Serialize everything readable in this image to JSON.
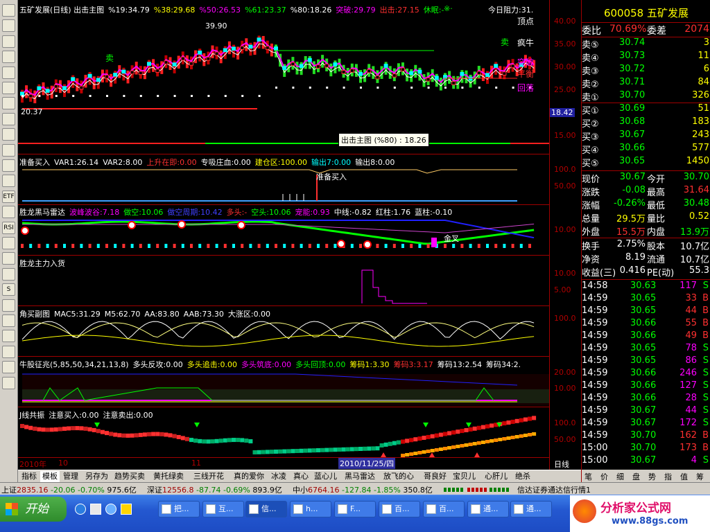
{
  "left_toolbar": {
    "buttons": [
      "",
      "",
      "",
      "",
      "",
      "",
      "",
      "",
      "",
      "",
      "",
      "",
      "ETF",
      "",
      "RSI",
      "",
      "",
      "",
      "S",
      "",
      "",
      "",
      "",
      "",
      ""
    ]
  },
  "main_pane": {
    "title_parts": [
      {
        "text": "五矿发展(日线) 出击主图",
        "color": "#ffffff"
      },
      {
        "text": "%19:34.79",
        "color": "#ffffff"
      },
      {
        "text": "%38:29.68",
        "color": "#ffff00"
      },
      {
        "text": "%50:26.53",
        "color": "#ff00ff"
      },
      {
        "text": "%61:23.37",
        "color": "#00ff00"
      },
      {
        "text": "%80:18.26",
        "color": "#ffffff"
      },
      {
        "text": "突破:29.79",
        "color": "#ff00ff"
      },
      {
        "text": "出击:27.15",
        "color": "#ff3030"
      },
      {
        "text": "休眠:-",
        "color": "#00ff00"
      }
    ],
    "x_mark": "※·",
    "resistance": "今日阻力:31.",
    "price_high_label": "39.90",
    "price_low_label": "20.37",
    "current_price_tag": "18.42",
    "tooltip": "出击主图 (%80) : 18.26",
    "labels": [
      {
        "text": "顶点",
        "color": "#ffffff"
      },
      {
        "text": "疯牛",
        "color": "#ffffff"
      },
      {
        "text": "突破",
        "color": "#ff00ff"
      },
      {
        "text": "平衡",
        "color": "#ff3030"
      },
      {
        "text": "回落",
        "color": "#ff00ff"
      }
    ],
    "sell_marks": [
      "卖",
      "卖"
    ],
    "y_ticks": [
      "40.00",
      "35.00",
      "30.00",
      "25.00",
      "20.00",
      "15.00"
    ]
  },
  "pane2": {
    "title_parts": [
      {
        "text": "准备买入",
        "color": "#ffffff"
      },
      {
        "text": "VAR1:26.14",
        "color": "#ffffff"
      },
      {
        "text": "VAR2:8.00",
        "color": "#ffffff"
      },
      {
        "text": "上升在即:0.00",
        "color": "#ff3030"
      },
      {
        "text": "专吸庄血:0.00",
        "color": "#ffffff"
      },
      {
        "text": "建仓区:100.00",
        "color": "#ffff00"
      },
      {
        "text": "输出7:0.00",
        "color": "#00ffff"
      },
      {
        "text": "输出8:0.00",
        "color": "#ffffff"
      }
    ],
    "marker": "准备买入",
    "y_ticks": [
      "100.0",
      "50.00"
    ]
  },
  "pane3": {
    "title_parts": [
      {
        "text": "胜龙黑马雷达",
        "color": "#ffffff"
      },
      {
        "text": "波峰波谷:7.18",
        "color": "#ff00ff"
      },
      {
        "text": "做空:10.06",
        "color": "#00ff00"
      },
      {
        "text": "做空周期:10.42",
        "color": "#4040ff"
      },
      {
        "text": "多头:-",
        "color": "#ff3030"
      },
      {
        "text": "空头:10.06",
        "color": "#00ff00"
      },
      {
        "text": "宠能:0.93",
        "color": "#ff00ff"
      },
      {
        "text": "中线:-0.82",
        "color": "#ffffff"
      },
      {
        "text": "红柱:1.76",
        "color": "#ffffff"
      },
      {
        "text": "蓝柱:-0.10",
        "color": "#ffffff"
      }
    ],
    "marker": "金叉",
    "y_ticks": [
      "10.00"
    ]
  },
  "pane4": {
    "title": "胜龙主力入货",
    "y_ticks": [
      "10.00",
      "5.00"
    ]
  },
  "pane5": {
    "title_parts": [
      {
        "text": "角买副图",
        "color": "#ffffff"
      },
      {
        "text": "MAC5:31.29",
        "color": "#ffffff"
      },
      {
        "text": "M5:62.70",
        "color": "#ffffff"
      },
      {
        "text": "AA:83.80",
        "color": "#ffffff"
      },
      {
        "text": "AAB:73.30",
        "color": "#ffffff"
      },
      {
        "text": "大涨区:0.00",
        "color": "#ffffff"
      }
    ],
    "y_ticks": [
      "100.0"
    ]
  },
  "pane6": {
    "title_parts": [
      {
        "text": "牛股征兆(5,85,50,34,21,13,8)",
        "color": "#ffffff"
      },
      {
        "text": "多头反攻:0.00",
        "color": "#ffffff"
      },
      {
        "text": "多头追击:0.00",
        "color": "#ffff00"
      },
      {
        "text": "多头筑底:0.00",
        "color": "#ff00ff"
      },
      {
        "text": "多头回顶:0.00",
        "color": "#00ff00"
      },
      {
        "text": "筹码1:3.30",
        "color": "#ffff00"
      },
      {
        "text": "筹码3:3.17",
        "color": "#ff3030"
      },
      {
        "text": "筹码13:2.54",
        "color": "#ffffff"
      },
      {
        "text": "筹码34:2.",
        "color": "#ffffff"
      }
    ],
    "y_ticks": [
      "20.00",
      "10.00"
    ]
  },
  "pane7": {
    "title_parts": [
      {
        "text": "J线共振",
        "color": "#ffffff"
      },
      {
        "text": "注意买入:0.00",
        "color": "#ffffff"
      },
      {
        "text": "注意卖出:0.00",
        "color": "#ffffff"
      }
    ],
    "y_ticks": [
      "100.0",
      "50.00"
    ]
  },
  "x_axis": {
    "labels": [
      "2010年",
      "10",
      "11"
    ],
    "cursor_date": "2010/11/25/四",
    "period": "日线"
  },
  "formula_tabs": [
    "指标",
    "模板",
    "管理",
    "另存为",
    "趋势买卖",
    "黄托绿卖",
    "三线开花",
    "真的爱你",
    "冰凌",
    "真心",
    "蓝心儿",
    "黑马雷达",
    "放飞的心",
    "哥良好",
    "宝贝儿",
    "心肝儿",
    "绝杀"
  ],
  "quote_panel": {
    "code": "600058",
    "name": "五矿发展",
    "weibi_label": "委比",
    "weibi": "70.69%",
    "weicha_label": "委差",
    "weicha": "2074",
    "asks": [
      {
        "label": "卖⑤",
        "price": "30.74",
        "vol": "3"
      },
      {
        "label": "卖④",
        "price": "30.73",
        "vol": "11"
      },
      {
        "label": "卖③",
        "price": "30.72",
        "vol": "6"
      },
      {
        "label": "卖②",
        "price": "30.71",
        "vol": "84"
      },
      {
        "label": "卖①",
        "price": "30.70",
        "vol": "326"
      }
    ],
    "bids": [
      {
        "label": "买①",
        "price": "30.69",
        "vol": "51"
      },
      {
        "label": "买②",
        "price": "30.68",
        "vol": "183"
      },
      {
        "label": "买③",
        "price": "30.67",
        "vol": "243"
      },
      {
        "label": "买④",
        "price": "30.66",
        "vol": "577"
      },
      {
        "label": "买⑤",
        "price": "30.65",
        "vol": "1450"
      }
    ],
    "stats": [
      {
        "l1": "现价",
        "v1": "30.67",
        "c1": "#00ff00",
        "l2": "今开",
        "v2": "30.70",
        "c2": "#00ff00"
      },
      {
        "l1": "涨跌",
        "v1": "-0.08",
        "c1": "#00ff00",
        "l2": "最高",
        "v2": "31.64",
        "c2": "#ff3030"
      },
      {
        "l1": "涨幅",
        "v1": "-0.26%",
        "c1": "#00ff00",
        "l2": "最低",
        "v2": "30.48",
        "c2": "#00ff00"
      },
      {
        "l1": "总量",
        "v1": "29.5万",
        "c1": "#ffff00",
        "l2": "量比",
        "v2": "0.52",
        "c2": "#ffff00"
      },
      {
        "l1": "外盘",
        "v1": "15.5万",
        "c1": "#ff3030",
        "l2": "内盘",
        "v2": "13.9万",
        "c2": "#00ff00"
      }
    ],
    "stats2": [
      {
        "l1": "换手",
        "v1": "2.75%",
        "l2": "股本",
        "v2": "10.7亿"
      },
      {
        "l1": "净资",
        "v1": "8.19",
        "l2": "流通",
        "v2": "10.7亿"
      },
      {
        "l1": "收益(三)",
        "v1": "0.416",
        "l2": "PE(动)",
        "v2": "55.3"
      }
    ],
    "ticks": [
      {
        "t": "14:58",
        "p": "30.63",
        "v": "117",
        "s": "S"
      },
      {
        "t": "14:59",
        "p": "30.65",
        "v": "33",
        "s": "B"
      },
      {
        "t": "14:59",
        "p": "30.65",
        "v": "44",
        "s": "B"
      },
      {
        "t": "14:59",
        "p": "30.66",
        "v": "55",
        "s": "B"
      },
      {
        "t": "14:59",
        "p": "30.66",
        "v": "49",
        "s": "B"
      },
      {
        "t": "14:59",
        "p": "30.65",
        "v": "78",
        "s": "S"
      },
      {
        "t": "14:59",
        "p": "30.65",
        "v": "86",
        "s": "S"
      },
      {
        "t": "14:59",
        "p": "30.66",
        "v": "246",
        "s": "S"
      },
      {
        "t": "14:59",
        "p": "30.66",
        "v": "127",
        "s": "S"
      },
      {
        "t": "14:59",
        "p": "30.66",
        "v": "28",
        "s": "S"
      },
      {
        "t": "14:59",
        "p": "30.67",
        "v": "44",
        "s": "S"
      },
      {
        "t": "14:59",
        "p": "30.67",
        "v": "172",
        "s": "S"
      },
      {
        "t": "14:59",
        "p": "30.70",
        "v": "162",
        "s": "B"
      },
      {
        "t": "15:00",
        "p": "30.70",
        "v": "173",
        "s": "B"
      },
      {
        "t": "15:00",
        "p": "30.67",
        "v": "4",
        "s": "S"
      }
    ],
    "bottom_tabs": [
      "笔",
      "价",
      "细",
      "盘",
      "势",
      "指",
      "值",
      "筹"
    ]
  },
  "status_bar": {
    "sh_label": "上证",
    "sh_val": "2835.16",
    "sh_chg": "-20.06",
    "sh_pct": "-0.70%",
    "sh_amt": "975.6亿",
    "sz_label": "深证",
    "sz_val": "12556.8",
    "sz_chg": "-87.74",
    "sz_pct": "-0.69%",
    "sz_amt": "893.9亿",
    "zx_label": "中小",
    "zx_val": "6764.16",
    "zx_chg": "-127.84",
    "zx_pct": "-1.85%",
    "zx_amt": "350.8亿",
    "broker": "信达证券通达信行情1"
  },
  "taskbar": {
    "start": "开始",
    "items": [
      "把...",
      "互...",
      "信...",
      "h...",
      "F...",
      "百...",
      "百...",
      "通...",
      "通..."
    ],
    "watermark_title": "分析家公式网",
    "watermark_url": "www.88gs.com"
  }
}
